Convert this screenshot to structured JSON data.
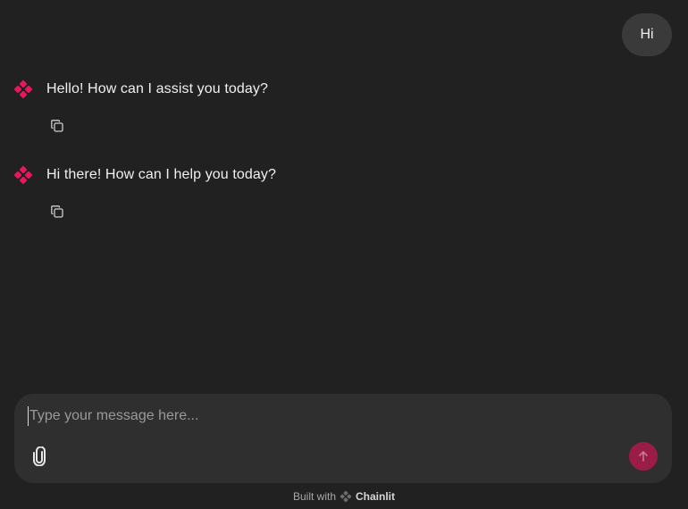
{
  "user_message": {
    "text": "Hi"
  },
  "assistant_messages": [
    {
      "text": "Hello! How can I assist you today?",
      "copy_icon": "copy-icon"
    },
    {
      "text": "Hi there! How can I help you today?",
      "copy_icon": "copy-icon"
    }
  ],
  "composer": {
    "placeholder": "Type your message here...",
    "attach_icon": "paperclip-icon",
    "send_icon": "arrow-up-icon"
  },
  "footer": {
    "built_with": "Built with",
    "brand": "Chainlit"
  },
  "colors": {
    "background": "#212121",
    "accent": "#e8175d",
    "send_button": "#9b1c47",
    "user_bubble": "#3a3a3a",
    "composer": "#2f2f2f"
  }
}
